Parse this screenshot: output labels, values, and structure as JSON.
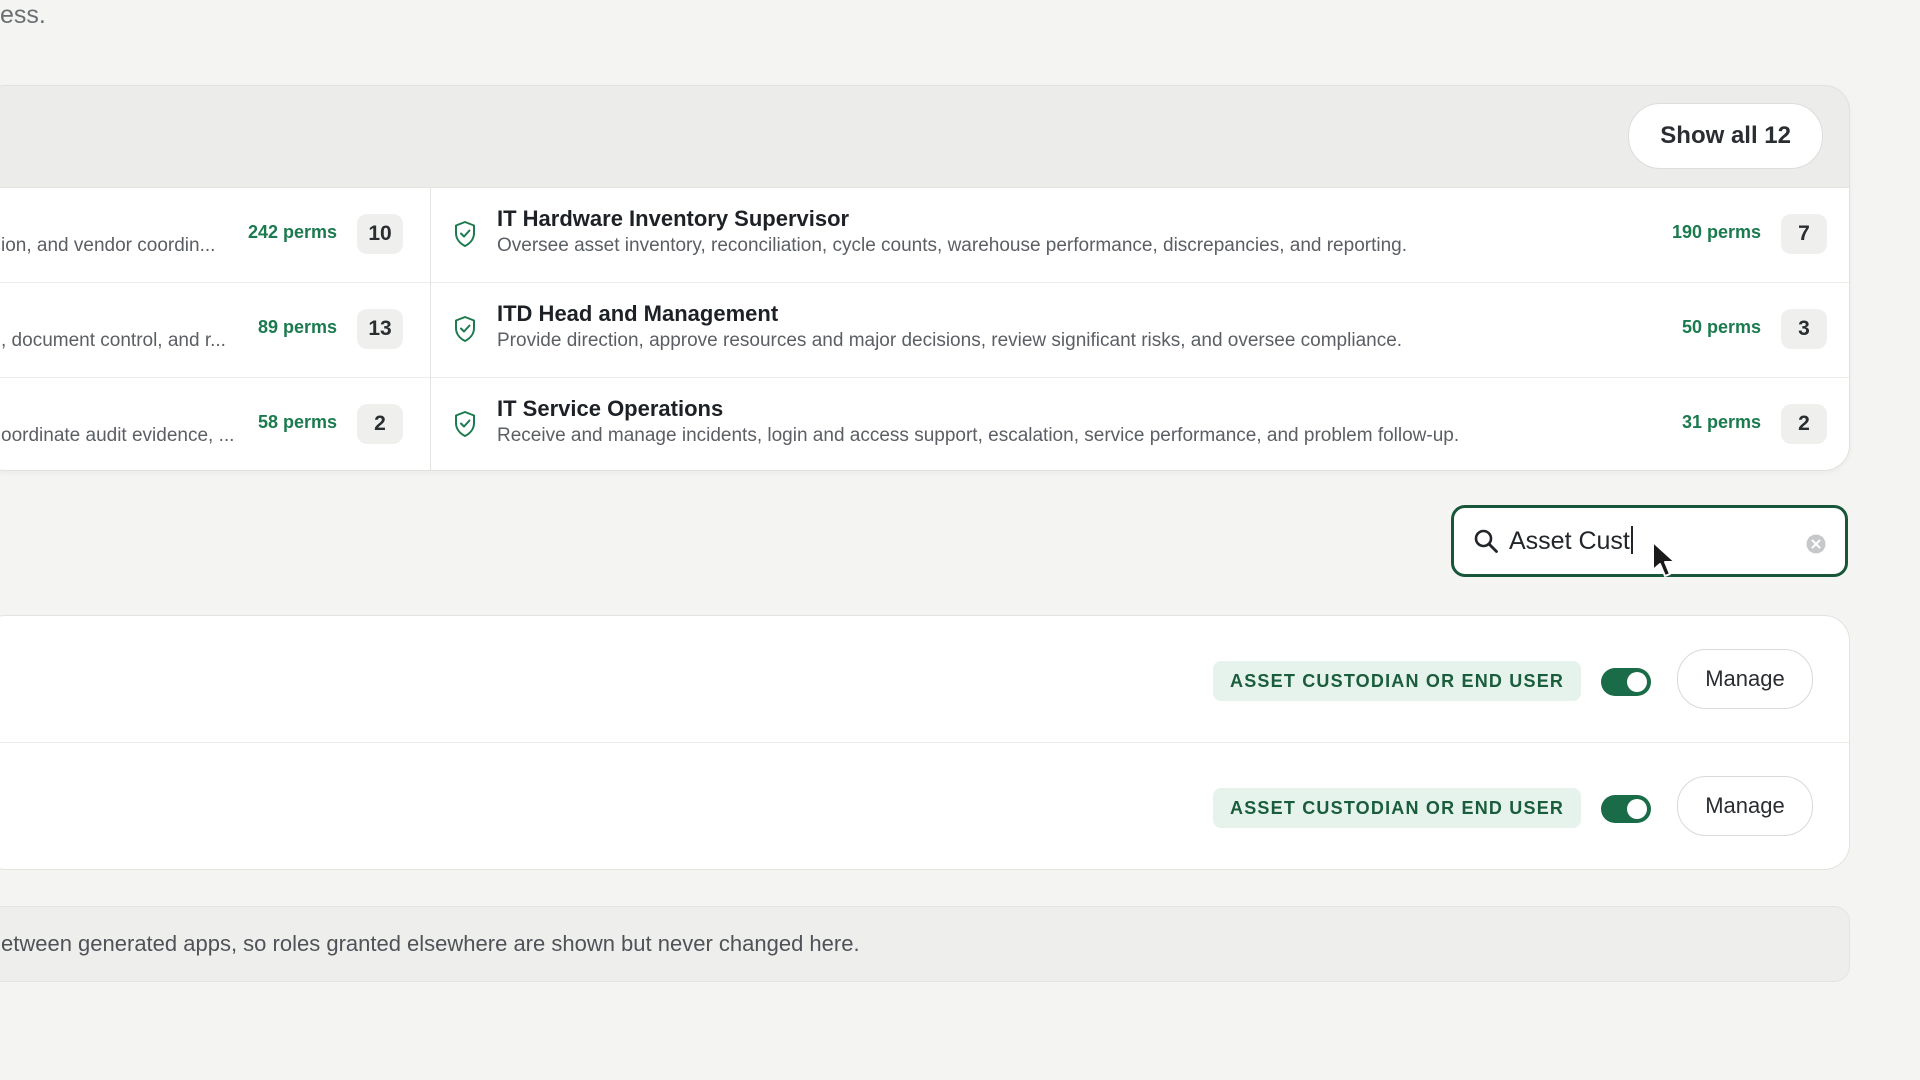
{
  "intro": {
    "text": "ess."
  },
  "roles": {
    "show_all_label": "Show all 12",
    "left": [
      {
        "desc": "ion, and vendor coordin...",
        "perms": "242 perms",
        "count": "10"
      },
      {
        "desc": ", document control, and r...",
        "perms": "89 perms",
        "count": "13"
      },
      {
        "desc": "oordinate audit evidence, ...",
        "perms": "58 perms",
        "count": "2"
      }
    ],
    "right": [
      {
        "title": "IT Hardware Inventory Supervisor",
        "desc": "Oversee asset inventory, reconciliation, cycle counts, warehouse performance, discrepancies, and reporting.",
        "perms": "190 perms",
        "count": "7",
        "icon": "shield-check-icon"
      },
      {
        "title": "ITD Head and Management",
        "desc": "Provide direction, approve resources and major decisions, review significant risks, and oversee compliance.",
        "perms": "50 perms",
        "count": "3",
        "icon": "shield-check-icon"
      },
      {
        "title": "IT Service Operations",
        "desc": "Receive and manage incidents, login and access support, escalation, service performance, and problem follow-up.",
        "perms": "31 perms",
        "count": "2",
        "icon": "shield-check-icon"
      }
    ]
  },
  "search": {
    "value": "Asset Cust",
    "icon": "search-icon",
    "clear_icon": "clear-icon"
  },
  "users": [
    {
      "role": "ASSET CUSTODIAN OR END USER",
      "enabled": true,
      "manage_label": "Manage"
    },
    {
      "role": "ASSET CUSTODIAN OR END USER",
      "enabled": true,
      "manage_label": "Manage"
    }
  ],
  "note": {
    "text": "etween generated apps, so roles granted elsewhere are shown but never changed here."
  },
  "colors": {
    "accent": "#1a6b47",
    "perms": "#1b7a4e",
    "pill_bg": "#e6f3ec",
    "pill_text": "#1a5d3c"
  }
}
